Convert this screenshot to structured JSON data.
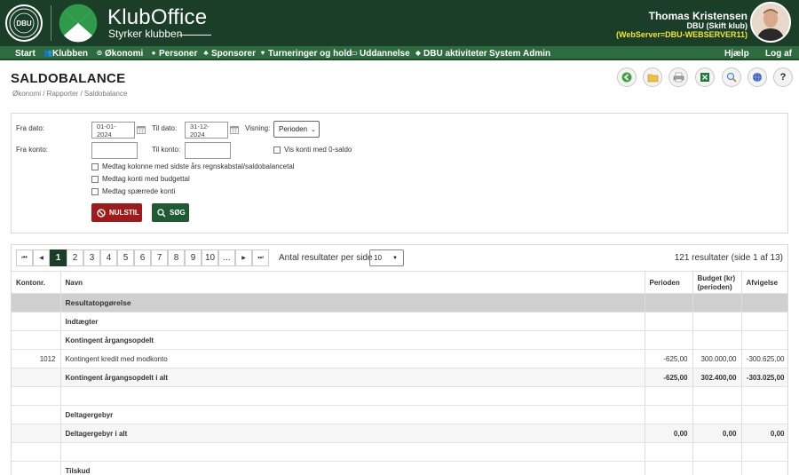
{
  "header": {
    "brand_title": "KlubOffice",
    "brand_subtitle": "Styrker klubben",
    "user_name": "Thomas Kristensen",
    "user_club": "DBU (Skift klub)",
    "user_server": "(WebServer=DBU-WEBSERVER11)"
  },
  "nav": {
    "items": [
      {
        "label": "Start",
        "icon": ""
      },
      {
        "label": "Klubben",
        "icon": "people-icon"
      },
      {
        "label": "Økonomi",
        "icon": "coin-icon"
      },
      {
        "label": "Personer",
        "icon": "person-icon"
      },
      {
        "label": "Sponsorer",
        "icon": "handshake-icon"
      },
      {
        "label": "Turneringer og hold",
        "icon": "trophy-icon"
      },
      {
        "label": "Uddannelse",
        "icon": "screen-icon"
      },
      {
        "label": "DBU aktiviteter",
        "icon": "graduation-icon"
      },
      {
        "label": "System Admin",
        "icon": ""
      }
    ],
    "help": "Hjælp",
    "logout": "Log af"
  },
  "page": {
    "title": "SALDOBALANCE",
    "breadcrumb": "Økonomi / Rapporter / Saldobalance"
  },
  "toolbar": {
    "buttons": [
      "back-icon",
      "folder-icon",
      "print-icon",
      "excel-icon",
      "zoom-icon",
      "globe-icon",
      "help-icon"
    ],
    "help_glyph": "?"
  },
  "filters": {
    "fra_dato_label": "Fra dato:",
    "fra_dato_value": "01-01-2024",
    "til_dato_label": "Til dato:",
    "til_dato_value": "31-12-2024",
    "visning_label": "Visning:",
    "visning_value": "Perioden",
    "fra_konto_label": "Fra konto:",
    "fra_konto_value": "",
    "til_konto_label": "Til konto:",
    "til_konto_value": "",
    "vis_nul_label": "Vis konti med 0-saldo",
    "checkboxes": [
      "Medtag kolonne med sidste års regnskabstal/saldobalancetal",
      "Medtag konti med budgettal",
      "Medtag spærrede konti"
    ],
    "reset_label": "NULSTIL",
    "search_label": "SØG"
  },
  "pagination": {
    "first": "⏮",
    "prev": "◀",
    "pages": [
      "1",
      "2",
      "3",
      "4",
      "5",
      "6",
      "7",
      "8",
      "9",
      "10",
      "..."
    ],
    "next": "▶",
    "last": "⏭",
    "per_page_label": "Antal resultater per side",
    "per_page_value": "10",
    "result_count": "121 resultater (side 1 af 13)"
  },
  "table": {
    "headers": {
      "konto": "Kontonr.",
      "navn": "Navn",
      "perioden": "Perioden",
      "budget": "Budget (kr) (perioden)",
      "afvigelse": "Afvigelse"
    },
    "rows": [
      {
        "type": "section",
        "konto": "",
        "navn": "Resultatopgørelse",
        "perioden": "",
        "budget": "",
        "afvigelse": ""
      },
      {
        "type": "group",
        "konto": "",
        "navn": "Indtægter",
        "perioden": "",
        "budget": "",
        "afvigelse": ""
      },
      {
        "type": "group",
        "konto": "",
        "navn": "Kontingent årgangsopdelt",
        "perioden": "",
        "budget": "",
        "afvigelse": ""
      },
      {
        "type": "row",
        "konto": "1012",
        "navn": "Kontingent kredit med modkonto",
        "perioden": "-625,00",
        "budget": "300.000,00",
        "afvigelse": "-300.625,00"
      },
      {
        "type": "total",
        "konto": "",
        "navn": "Kontingent årgangsopdelt i alt",
        "perioden": "-625,00",
        "budget": "302.400,00",
        "afvigelse": "-303.025,00"
      },
      {
        "type": "blank",
        "konto": "",
        "navn": "",
        "perioden": "",
        "budget": "",
        "afvigelse": ""
      },
      {
        "type": "group",
        "konto": "",
        "navn": "Deltagergebyr",
        "perioden": "",
        "budget": "",
        "afvigelse": ""
      },
      {
        "type": "group",
        "konto": "",
        "navn": "Deltagergebyr i alt",
        "perioden": "0,00",
        "budget": "0,00",
        "afvigelse": "0,00"
      },
      {
        "type": "blank",
        "konto": "",
        "navn": "",
        "perioden": "",
        "budget": "",
        "afvigelse": ""
      },
      {
        "type": "group",
        "konto": "",
        "navn": "Tilskud",
        "perioden": "",
        "budget": "",
        "afvigelse": ""
      }
    ]
  },
  "colors": {
    "header_bg": "#1a3e28",
    "nav_bg": "#2e6b3f",
    "reset_btn": "#9e1b1b",
    "search_btn": "#1f5a33",
    "server_text": "#f2e531"
  }
}
